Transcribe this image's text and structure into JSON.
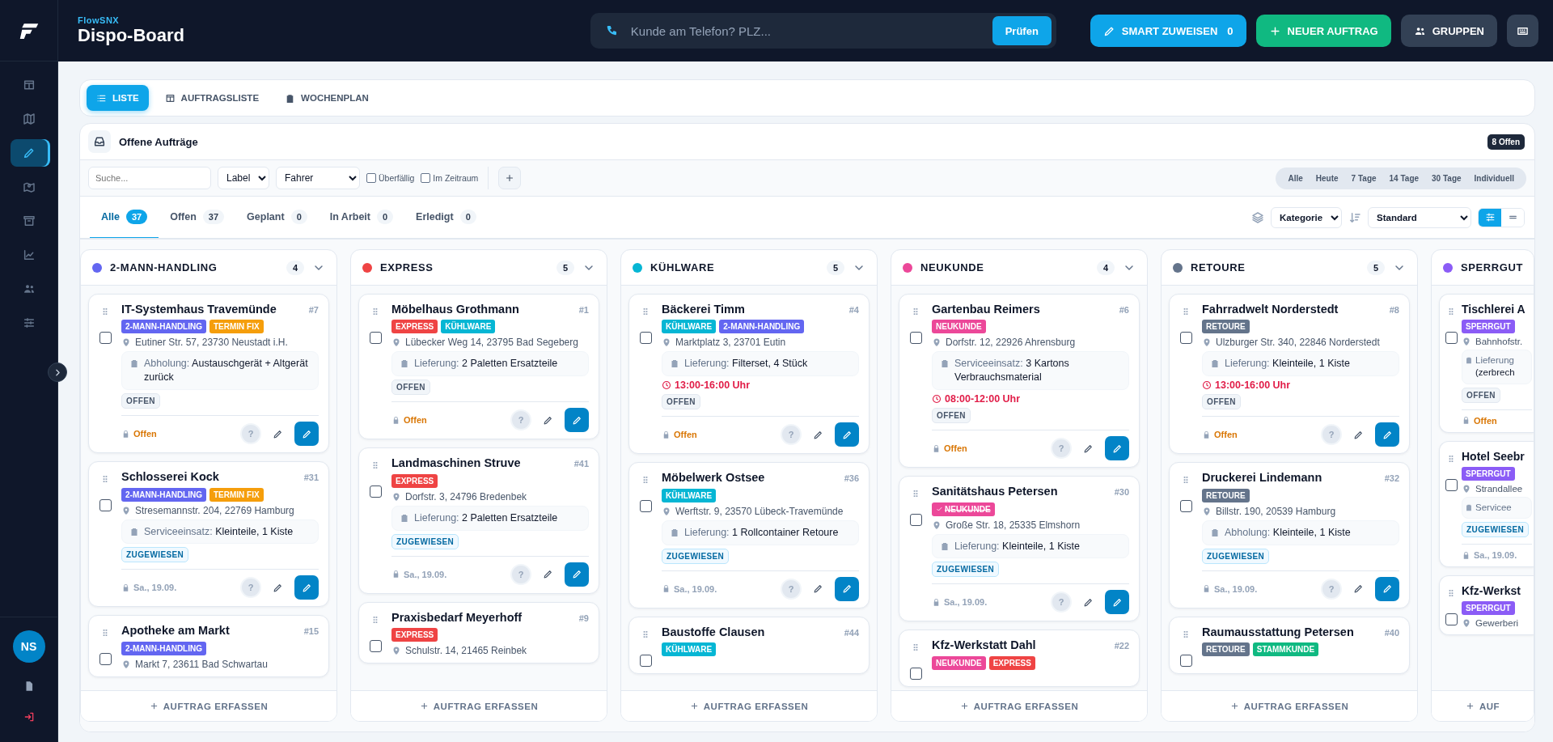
{
  "sidebar": {
    "items": [
      {
        "selected": false
      },
      {
        "selected": false
      },
      {
        "selected": true
      },
      {
        "selected": false
      },
      {
        "selected": false
      },
      {
        "selected": false
      },
      {
        "selected": false
      },
      {
        "selected": false
      }
    ],
    "avatar": "NS"
  },
  "header": {
    "brand": "FlowSNX",
    "title": "Dispo-Board",
    "phone_search": {
      "placeholder": "Kunde am Telefon? PLZ...",
      "button": "Prüfen"
    },
    "actions": [
      {
        "kind": "smart",
        "label": "SMART ZUWEISEN",
        "count": "0"
      },
      {
        "kind": "new",
        "label": "NEUER AUFTRAG"
      },
      {
        "kind": "groups",
        "label": "GRUPPEN"
      },
      {
        "kind": "keyboard"
      }
    ]
  },
  "view_tabs": [
    {
      "label": "LISTE",
      "selected": true
    },
    {
      "label": "AUFTRAGSLISTE",
      "selected": false
    },
    {
      "label": "WOCHENPLAN",
      "selected": false
    }
  ],
  "panel": {
    "title": "Offene Aufträge",
    "badge": "8 Offen",
    "filters": {
      "search_placeholder": "Suche...",
      "label_select": "Label",
      "driver_select": "Fahrer",
      "checkboxes": [
        {
          "label": "Überfällig",
          "checked": false
        },
        {
          "label": "Im Zeitraum",
          "checked": false
        }
      ],
      "ranges": [
        {
          "label": "Alle",
          "selected": false
        },
        {
          "label": "Heute",
          "selected": false
        },
        {
          "label": "7 Tage",
          "selected": false
        },
        {
          "label": "14 Tage",
          "selected": false
        },
        {
          "label": "30 Tage",
          "selected": false
        },
        {
          "label": "Individuell",
          "selected": false
        }
      ]
    },
    "status_tabs": [
      {
        "label": "Alle",
        "count": "37",
        "selected": true
      },
      {
        "label": "Offen",
        "count": "37",
        "selected": false
      },
      {
        "label": "Geplant",
        "count": "0",
        "selected": false
      },
      {
        "label": "In Arbeit",
        "count": "0",
        "selected": false
      },
      {
        "label": "Erledigt",
        "count": "0",
        "selected": false
      }
    ],
    "group_select": "Kategorie",
    "sort_select": "Standard",
    "view_toggle": [
      {
        "selected": true
      },
      {
        "selected": false
      }
    ]
  },
  "columns": [
    {
      "title": "2-MANN-HANDLING",
      "color": "#6366f1",
      "count": "4",
      "add": "AUFTRAG ERFASSEN",
      "cards": [
        {
          "title": "IT-Systemhaus Travemünde",
          "number": "#7",
          "checked": false,
          "tags": [
            {
              "text": "2-MANN-HANDLING",
              "color": "#6366f1",
              "done": false
            },
            {
              "text": "TERMIN FIX",
              "color": "#f59e0b",
              "done": false
            }
          ],
          "address": "Eutiner Str. 57, 23730 Neustadt i.H.",
          "detail": {
            "label": "Abholung:",
            "value": "Austauschgerät + Altgerät zurück"
          },
          "status": {
            "text": "OFFEN",
            "kind": "open"
          },
          "footer": {
            "text": "Offen",
            "kind": "open"
          },
          "help": "?"
        },
        {
          "title": "Schlosserei Kock",
          "number": "#31",
          "checked": false,
          "tags": [
            {
              "text": "2-MANN-HANDLING",
              "color": "#6366f1",
              "done": false
            },
            {
              "text": "TERMIN FIX",
              "color": "#f59e0b",
              "done": false
            }
          ],
          "address": "Stresemannstr. 204, 22769 Hamburg",
          "detail": {
            "label": "Serviceeinsatz:",
            "value": "Kleinteile, 1 Kiste"
          },
          "status": {
            "text": "ZUGEWIESEN",
            "kind": "assigned"
          },
          "footer": {
            "text": "Sa., 19.09.",
            "kind": "date"
          },
          "help": "?"
        },
        {
          "title": "Apotheke am Markt",
          "number": "#15",
          "checked": false,
          "tags": [
            {
              "text": "2-MANN-HANDLING",
              "color": "#6366f1",
              "done": false
            }
          ],
          "address": "Markt 7, 23611 Bad Schwartau"
        }
      ]
    },
    {
      "title": "EXPRESS",
      "color": "#ef4444",
      "count": "5",
      "add": "AUFTRAG ERFASSEN",
      "cards": [
        {
          "title": "Möbelhaus Grothmann",
          "number": "#1",
          "checked": false,
          "tags": [
            {
              "text": "EXPRESS",
              "color": "#ef4444",
              "done": false
            },
            {
              "text": "KÜHLWARE",
              "color": "#06b6d4",
              "done": false
            }
          ],
          "address": "Lübecker Weg 14, 23795 Bad Segeberg",
          "detail": {
            "label": "Lieferung:",
            "value": "2 Paletten Ersatzteile"
          },
          "status": {
            "text": "OFFEN",
            "kind": "open"
          },
          "footer": {
            "text": "Offen",
            "kind": "open"
          },
          "help": "?"
        },
        {
          "title": "Landmaschinen Struve",
          "number": "#41",
          "checked": false,
          "tags": [
            {
              "text": "EXPRESS",
              "color": "#ef4444",
              "done": false
            }
          ],
          "address": "Dorfstr. 3, 24796 Bredenbek",
          "detail": {
            "label": "Lieferung:",
            "value": "2 Paletten Ersatzteile"
          },
          "status": {
            "text": "ZUGEWIESEN",
            "kind": "assigned"
          },
          "footer": {
            "text": "Sa., 19.09.",
            "kind": "date"
          },
          "help": "?"
        },
        {
          "title": "Praxisbedarf Meyerhoff",
          "number": "#9",
          "checked": false,
          "tags": [
            {
              "text": "EXPRESS",
              "color": "#ef4444",
              "done": false
            }
          ],
          "address": "Schulstr. 14, 21465 Reinbek"
        }
      ]
    },
    {
      "title": "KÜHLWARE",
      "color": "#06b6d4",
      "count": "5",
      "add": "AUFTRAG ERFASSEN",
      "cards": [
        {
          "title": "Bäckerei Timm",
          "number": "#4",
          "checked": false,
          "tags": [
            {
              "text": "KÜHLWARE",
              "color": "#06b6d4",
              "done": false
            },
            {
              "text": "2-MANN-HANDLING",
              "color": "#6366f1",
              "done": false
            }
          ],
          "address": "Marktplatz 3, 23701 Eutin",
          "detail": {
            "label": "Lieferung:",
            "value": "Filterset, 4 Stück"
          },
          "time": "13:00-16:00 Uhr",
          "status": {
            "text": "OFFEN",
            "kind": "open"
          },
          "footer": {
            "text": "Offen",
            "kind": "open"
          },
          "help": "?"
        },
        {
          "title": "Möbelwerk Ostsee",
          "number": "#36",
          "checked": false,
          "tags": [
            {
              "text": "KÜHLWARE",
              "color": "#06b6d4",
              "done": false
            }
          ],
          "address": "Werftstr. 9, 23570 Lübeck-Travemünde",
          "detail": {
            "label": "Lieferung:",
            "value": "1 Rollcontainer Retoure"
          },
          "status": {
            "text": "ZUGEWIESEN",
            "kind": "assigned"
          },
          "footer": {
            "text": "Sa., 19.09.",
            "kind": "date"
          },
          "help": "?"
        },
        {
          "title": "Baustoffe Clausen",
          "number": "#44",
          "checked": false,
          "tags": [
            {
              "text": "KÜHLWARE",
              "color": "#06b6d4",
              "done": false
            }
          ]
        }
      ]
    },
    {
      "title": "NEUKUNDE",
      "color": "#ec4899",
      "count": "4",
      "add": "AUFTRAG ERFASSEN",
      "cards": [
        {
          "title": "Gartenbau Reimers",
          "number": "#6",
          "checked": false,
          "tags": [
            {
              "text": "NEUKUNDE",
              "color": "#ec4899",
              "done": false
            }
          ],
          "address": "Dorfstr. 12, 22926 Ahrensburg",
          "detail": {
            "label": "Serviceeinsatz:",
            "value": "3 Kartons Verbrauchsmaterial"
          },
          "time": "08:00-12:00 Uhr",
          "status": {
            "text": "OFFEN",
            "kind": "open"
          },
          "footer": {
            "text": "Offen",
            "kind": "open"
          },
          "help": "?"
        },
        {
          "title": "Sanitätshaus Petersen",
          "number": "#30",
          "checked": false,
          "tags": [
            {
              "text": "NEUKUNDE",
              "color": "#ec4899",
              "done": true
            }
          ],
          "address": "Große Str. 18, 25335 Elmshorn",
          "detail": {
            "label": "Lieferung:",
            "value": "Kleinteile, 1 Kiste"
          },
          "status": {
            "text": "ZUGEWIESEN",
            "kind": "assigned"
          },
          "footer": {
            "text": "Sa., 19.09.",
            "kind": "date"
          },
          "help": "?"
        },
        {
          "title": "Kfz-Werkstatt Dahl",
          "number": "#22",
          "checked": false,
          "tags": [
            {
              "text": "NEUKUNDE",
              "color": "#ec4899",
              "done": false
            },
            {
              "text": "EXPRESS",
              "color": "#ef4444",
              "done": false
            }
          ]
        }
      ]
    },
    {
      "title": "RETOURE",
      "color": "#64748b",
      "count": "5",
      "add": "AUFTRAG ERFASSEN",
      "cards": [
        {
          "title": "Fahrradwelt Norderstedt",
          "number": "#8",
          "checked": false,
          "tags": [
            {
              "text": "RETOURE",
              "color": "#64748b",
              "done": false
            }
          ],
          "address": "Ulzburger Str. 340, 22846 Norderstedt",
          "detail": {
            "label": "Lieferung:",
            "value": "Kleinteile, 1 Kiste"
          },
          "time": "13:00-16:00 Uhr",
          "status": {
            "text": "OFFEN",
            "kind": "open"
          },
          "footer": {
            "text": "Offen",
            "kind": "open"
          },
          "help": "?"
        },
        {
          "title": "Druckerei Lindemann",
          "number": "#32",
          "checked": false,
          "tags": [
            {
              "text": "RETOURE",
              "color": "#64748b",
              "done": false
            }
          ],
          "address": "Billstr. 190, 20539 Hamburg",
          "detail": {
            "label": "Abholung:",
            "value": "Kleinteile, 1 Kiste"
          },
          "status": {
            "text": "ZUGEWIESEN",
            "kind": "assigned"
          },
          "footer": {
            "text": "Sa., 19.09.",
            "kind": "date"
          },
          "help": "?"
        },
        {
          "title": "Raumausstattung Petersen",
          "number": "#40",
          "checked": false,
          "tags": [
            {
              "text": "RETOURE",
              "color": "#64748b",
              "done": false
            },
            {
              "text": "STAMMKUNDE",
              "color": "#10b981",
              "done": false
            }
          ]
        }
      ]
    },
    {
      "title": "SPERRGUT",
      "color": "#8b5cf6",
      "add": "AUF",
      "cards": [
        {
          "title": "Tischlerei A",
          "checked": false,
          "tags": [
            {
              "text": "SPERRGUT",
              "color": "#8b5cf6",
              "done": false
            }
          ],
          "address": "Bahnhofstr.",
          "detail": {
            "label": "Lieferung",
            "value": "(zerbrech"
          },
          "status": {
            "text": "OFFEN",
            "kind": "open"
          },
          "footer": {
            "text": "Offen",
            "kind": "open"
          }
        },
        {
          "title": "Hotel Seebr",
          "checked": false,
          "tags": [
            {
              "text": "SPERRGUT",
              "color": "#8b5cf6",
              "done": false
            }
          ],
          "address": "Strandallee",
          "detail": {
            "label": "Servicee"
          },
          "status": {
            "text": "ZUGEWIESEN",
            "kind": "assigned"
          },
          "footer": {
            "text": "Sa., 19.09.",
            "kind": "date"
          }
        },
        {
          "title": "Kfz-Werkst",
          "checked": false,
          "tags": [
            {
              "text": "SPERRGUT",
              "color": "#8b5cf6",
              "done": false
            }
          ],
          "address": "Gewerberi"
        }
      ]
    }
  ]
}
